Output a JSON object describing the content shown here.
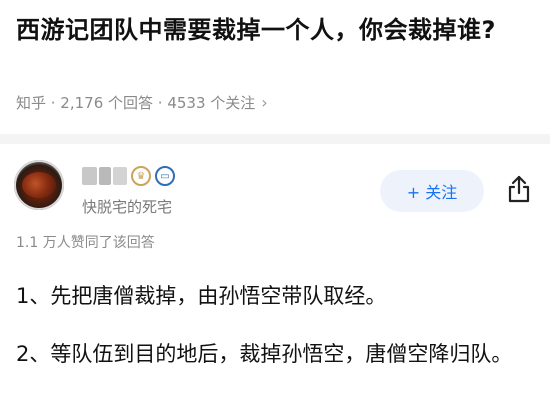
{
  "question": {
    "title": "西游记团队中需要裁掉一个人，你会裁掉谁?",
    "meta": "知乎 · 2,176 个回答 · 4533 个关注",
    "chevron": "›"
  },
  "author": {
    "bio": "快脱宅的死宅",
    "avatar_icon": "avatar-food-icon"
  },
  "actions": {
    "follow_label": "+ 关注",
    "share_icon": "share-icon"
  },
  "answer": {
    "likes": "1.1 万人赞同了该回答",
    "p1": "1、先把唐僧裁掉，由孙悟空带队取经。",
    "p2": "2、等队伍到目的地后，裁掉孙悟空，唐僧空降归队。"
  },
  "colors": {
    "accent": "#1772f6",
    "follow_bg": "#eef3fb",
    "meta_gray": "#8a8a8a"
  }
}
